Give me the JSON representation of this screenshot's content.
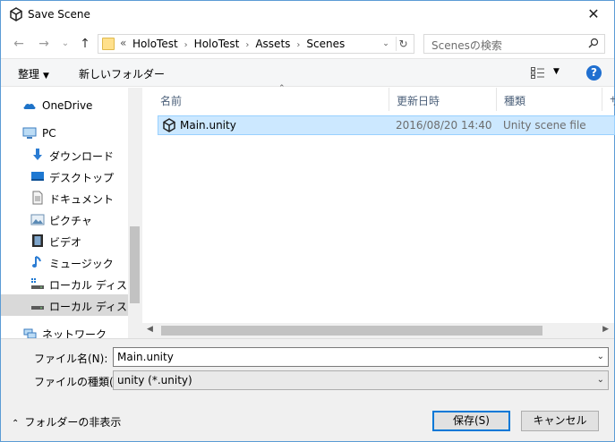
{
  "window": {
    "title": "Save Scene",
    "close_glyph": "✕"
  },
  "nav": {
    "back_glyph": "←",
    "forward_glyph": "→",
    "recent_glyph": "⌄",
    "up_glyph": "↑",
    "overflow": "«",
    "breadcrumbs": [
      "HoloTest",
      "HoloTest",
      "Assets",
      "Scenes"
    ],
    "crumb_sep": "›",
    "refresh_glyph": "↻",
    "dropdown_glyph": "⌄"
  },
  "search": {
    "placeholder": "Scenesの検索",
    "icon": "search-icon"
  },
  "toolbar": {
    "organize_label": "整理",
    "new_folder_label": "新しいフォルダー",
    "help_glyph": "?"
  },
  "sidebar": {
    "items": [
      {
        "label": "OneDrive",
        "icon": "onedrive-icon"
      },
      {
        "label": "PC",
        "icon": "pc-icon"
      },
      {
        "label": "ダウンロード",
        "icon": "download-icon"
      },
      {
        "label": "デスクトップ",
        "icon": "desktop-icon"
      },
      {
        "label": "ドキュメント",
        "icon": "documents-icon"
      },
      {
        "label": "ピクチャ",
        "icon": "pictures-icon"
      },
      {
        "label": "ビデオ",
        "icon": "videos-icon"
      },
      {
        "label": "ミュージック",
        "icon": "music-icon"
      },
      {
        "label": "ローカル ディスク (C",
        "icon": "drive-c-icon"
      },
      {
        "label": "ローカル ディスク (D",
        "icon": "drive-d-icon"
      },
      {
        "label": "ネットワーク",
        "icon": "network-icon"
      }
    ]
  },
  "columns": {
    "name": "名前",
    "modified": "更新日時",
    "type": "種類",
    "size": "サ"
  },
  "files": [
    {
      "name": "Main.unity",
      "modified": "2016/08/20 14:40",
      "type": "Unity scene file",
      "icon": "unity-icon"
    }
  ],
  "bottom": {
    "filename_label": "ファイル名(N):",
    "filename_value": "Main.unity",
    "filetype_label": "ファイルの種類(T):",
    "filetype_value": "unity (*.unity)",
    "hide_folders_label": "フォルダーの非表示",
    "save_label": "保存(S)",
    "cancel_label": "キャンセル"
  },
  "colors": {
    "selection_bg": "#cce8ff",
    "selection_border": "#99d1ff",
    "accent": "#0078d7"
  }
}
